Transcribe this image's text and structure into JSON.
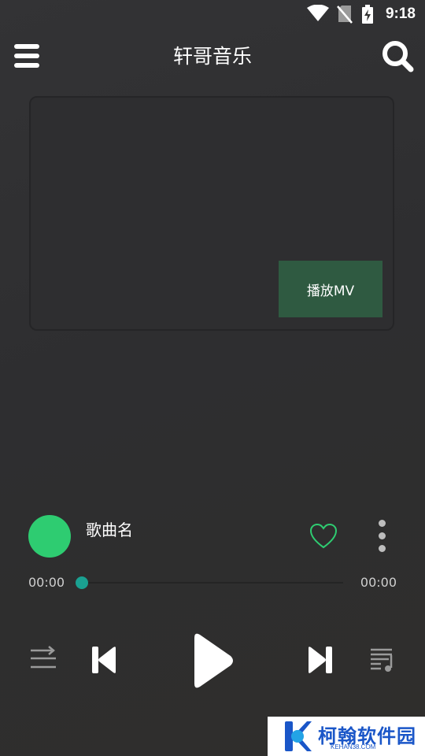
{
  "status_bar": {
    "time": "9:18",
    "icons": [
      "wifi-icon",
      "no-sim-icon",
      "battery-charging-icon"
    ]
  },
  "app_bar": {
    "title": "轩哥音乐",
    "menu_icon": "hamburger-menu-icon",
    "search_icon": "search-icon"
  },
  "mv_panel": {
    "play_mv_label": "播放MV"
  },
  "now_playing": {
    "song_name": "歌曲名",
    "album_art_color": "#2ecc71",
    "favorite_icon": "heart-outline-icon",
    "favorite_color": "#2ecc71",
    "more_icon": "more-vertical-icon"
  },
  "progress": {
    "current_time": "00:00",
    "total_time": "00:00",
    "fraction": 0,
    "accent_color": "#1aa191"
  },
  "controls": {
    "play_mode_icon": "repeat-list-icon",
    "previous_icon": "skip-previous-icon",
    "play_icon": "play-icon",
    "next_icon": "skip-next-icon",
    "playlist_icon": "playlist-music-icon"
  },
  "watermark": {
    "brand": "柯翰软件园",
    "domain": "KEHAN38.COM"
  }
}
